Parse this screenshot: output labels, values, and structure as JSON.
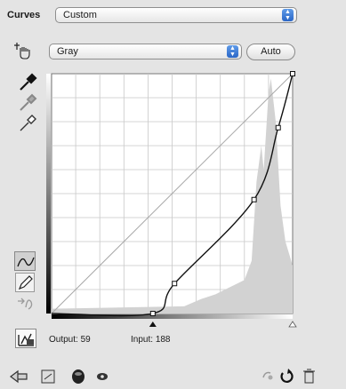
{
  "panel": {
    "title": "Curves",
    "preset": "Custom",
    "channel": "Gray",
    "auto_label": "Auto"
  },
  "readout": {
    "output_label": "Output:",
    "output_value": "59",
    "input_label": "Input:",
    "input_value": "188"
  },
  "curve": {
    "points": [
      [
        0,
        0
      ],
      [
        42,
        0
      ],
      [
        51,
        25
      ],
      [
        84,
        95
      ],
      [
        94,
        155
      ],
      [
        100,
        200
      ]
    ],
    "selected_point": 3,
    "scale_max": 100,
    "output_max": 200
  },
  "icons": {
    "target_adjust": "hand-target-icon",
    "black_eyedropper": "black-eyedropper-icon",
    "gray_eyedropper": "gray-eyedropper-icon",
    "white_eyedropper": "white-eyedropper-icon",
    "curve_tool": "curve-tool-icon",
    "pencil_tool": "pencil-tool-icon",
    "smooth_tool": "smooth-tool-icon",
    "clipping": "clipping-warning-icon"
  },
  "colors": {
    "panel_bg": "#e4e4e4",
    "histogram": "#d2d2d2",
    "curve": "#111111"
  }
}
